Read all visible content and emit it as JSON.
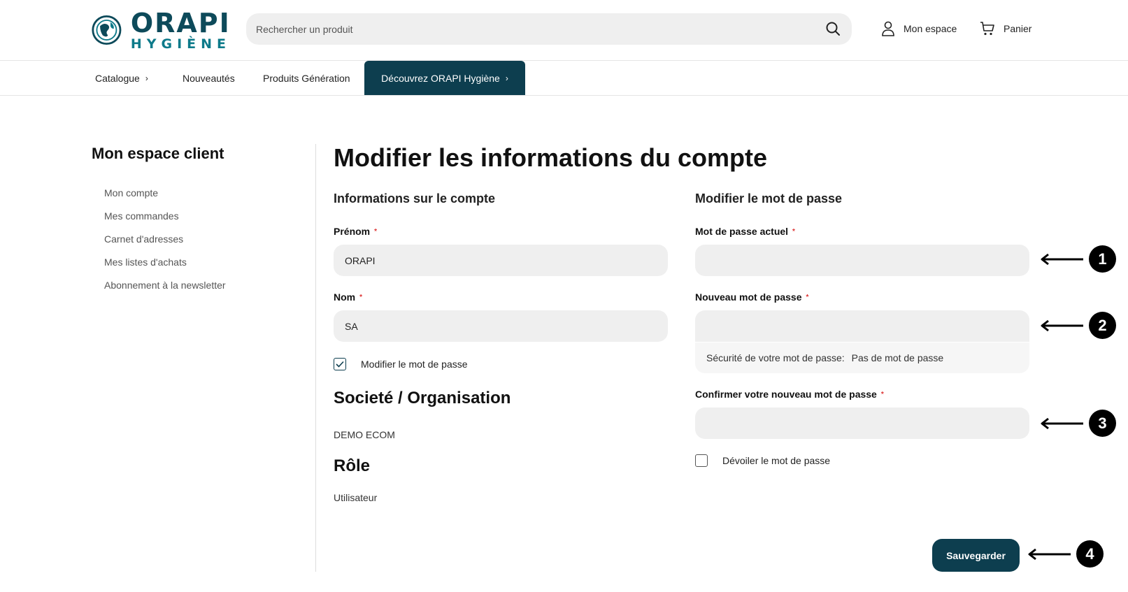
{
  "header": {
    "logo": {
      "line1": "ORAPI",
      "line2": "HYGIÈNE"
    },
    "search": {
      "placeholder": "Rechercher un produit",
      "value": ""
    },
    "account_label": "Mon espace",
    "cart_label": "Panier"
  },
  "nav": {
    "catalogue": "Catalogue",
    "nouveautes": "Nouveautés",
    "produits": "Produits Génération",
    "decouvrez": "Découvrez ORAPI Hygiène"
  },
  "sidebar": {
    "title": "Mon espace client",
    "items": [
      {
        "label": "Mon compte"
      },
      {
        "label": "Mes commandes"
      },
      {
        "label": "Carnet d'adresses"
      },
      {
        "label": "Mes listes d'achats"
      },
      {
        "label": "Abonnement à la newsletter"
      }
    ]
  },
  "main": {
    "title": "Modifier les informations du compte",
    "account_section": {
      "title": "Informations sur le compte",
      "prenom_label": "Prénom",
      "prenom_value": "ORAPI",
      "nom_label": "Nom",
      "nom_value": "SA",
      "change_password_label": "Modifier le mot de passe",
      "change_password_checked": true,
      "required_mark": "*"
    },
    "company": {
      "title": "Societé / Organisation",
      "value": "DEMO ECOM"
    },
    "role": {
      "title": "Rôle",
      "value": "Utilisateur"
    },
    "password_section": {
      "title": "Modifier le mot de passe",
      "current_label": "Mot de passe actuel",
      "current_value": "",
      "new_label": "Nouveau mot de passe",
      "new_value": "",
      "strength_label": "Sécurité de votre mot de passe:",
      "strength_value": "Pas de mot de passe",
      "confirm_label": "Confirmer votre nouveau mot de passe",
      "confirm_value": "",
      "reveal_label": "Dévoiler le mot de passe",
      "reveal_checked": false
    },
    "save_label": "Sauvegarder"
  },
  "markers": [
    "1",
    "2",
    "3",
    "4"
  ],
  "colors": {
    "primary": "#0d3e4f",
    "logo_dark": "#0d4a5a",
    "logo_light": "#0d7a8a",
    "field_bg": "#efefef",
    "required": "#d33333"
  }
}
